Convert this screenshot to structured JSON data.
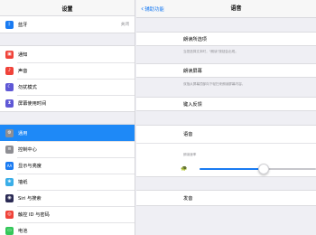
{
  "sidebar": {
    "title": "设置",
    "group1": [
      {
        "label": "蓝牙",
        "value": "关闭",
        "icon": "bluetooth-icon",
        "color": "#1a7bf2",
        "glyph": "ᛒ"
      }
    ],
    "group2": [
      {
        "label": "通知",
        "icon": "notifications-icon",
        "color": "#f0433a",
        "glyph": "▣"
      },
      {
        "label": "声音",
        "icon": "sound-icon",
        "color": "#f0433a",
        "glyph": "♪"
      },
      {
        "label": "勿扰模式",
        "icon": "moon-icon",
        "color": "#5f58d6",
        "glyph": "☾"
      },
      {
        "label": "屏幕使用时间",
        "icon": "hourglass-icon",
        "color": "#5f58d6",
        "glyph": "⧗"
      }
    ],
    "group3": [
      {
        "label": "通用",
        "icon": "gear-icon",
        "color": "#8e8e93",
        "glyph": "⚙",
        "selected": true
      },
      {
        "label": "控制中心",
        "icon": "control-center-icon",
        "color": "#8e8e93",
        "glyph": "≡"
      },
      {
        "label": "显示与亮度",
        "icon": "display-icon",
        "color": "#1a7bf2",
        "glyph": "AA"
      },
      {
        "label": "墙纸",
        "icon": "wallpaper-icon",
        "color": "#3aaee8",
        "glyph": "❀"
      },
      {
        "label": "Siri 与搜索",
        "icon": "siri-icon",
        "color": "#2b2b55",
        "glyph": "◉"
      },
      {
        "label": "触控 ID 与密码",
        "icon": "fingerprint-icon",
        "color": "#f0433a",
        "glyph": "◎"
      },
      {
        "label": "电池",
        "icon": "battery-icon",
        "color": "#34c759",
        "glyph": "▭"
      }
    ]
  },
  "detail": {
    "back_label": "辅助功能",
    "title": "语音",
    "speak_selection": "朗读所选项",
    "speak_selection_caption": "当您选择文本时，\"朗读\"按钮会出现。",
    "speak_screen": "朗读屏幕",
    "speak_screen_caption": "双指从屏幕顶部向下轻扫来朗读屏幕内容。",
    "typing_feedback": "键入反馈",
    "voices": "语音",
    "speaking_rate_label": "朗读速率",
    "speaking_rate": 0.55,
    "pronunciations": "发音"
  },
  "colors": {
    "accent": "#1a7bf2",
    "selected": "#1e89f7"
  }
}
